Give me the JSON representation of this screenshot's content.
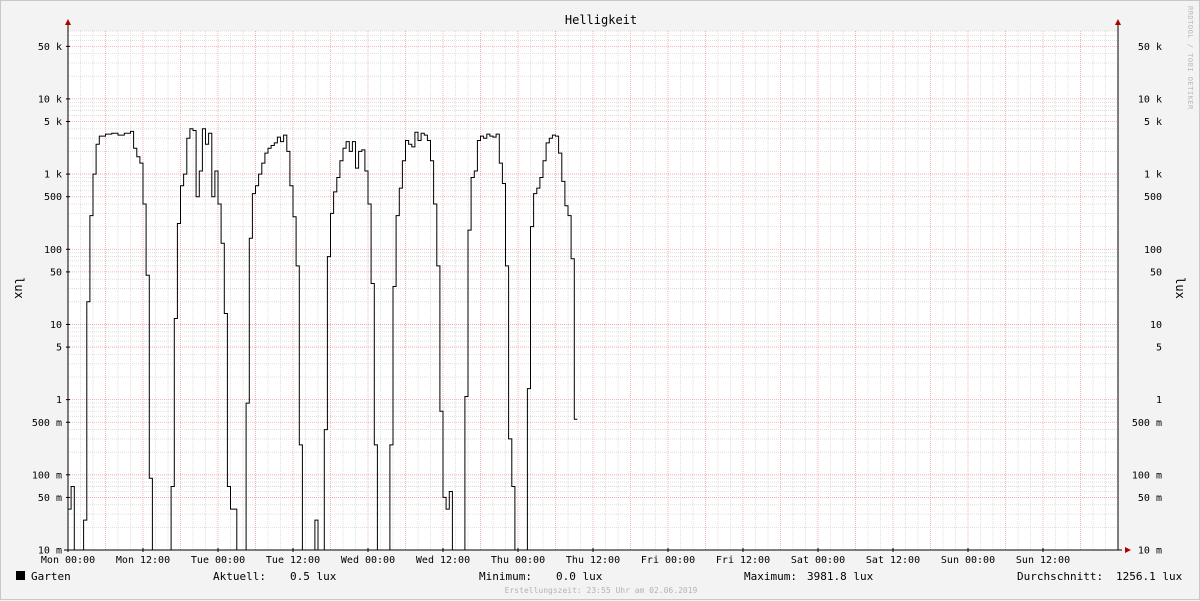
{
  "chart_data": {
    "type": "line",
    "title": "Helligkeit",
    "ylabel": "lux",
    "ylabel_right": "lux",
    "watermark": "RRDTOOL / TOBI OETIKER",
    "y_scale": "log",
    "ylim": [
      0.01,
      80000
    ],
    "xlim_hours": [
      0,
      168
    ],
    "x_tick_labels": [
      "Mon 00:00",
      "Mon 12:00",
      "Tue 00:00",
      "Tue 12:00",
      "Wed 00:00",
      "Wed 12:00",
      "Thu 00:00",
      "Thu 12:00",
      "Fri 00:00",
      "Fri 12:00",
      "Sat 00:00",
      "Sat 12:00",
      "Sun 00:00",
      "Sun 12:00"
    ],
    "x_tick_hours": [
      0,
      12,
      24,
      36,
      48,
      60,
      72,
      84,
      96,
      108,
      120,
      132,
      144,
      156
    ],
    "y_ticks": [
      {
        "value": 0.01,
        "label": "10 m"
      },
      {
        "value": 0.05,
        "label": "50 m"
      },
      {
        "value": 0.1,
        "label": "100 m"
      },
      {
        "value": 0.5,
        "label": "500 m"
      },
      {
        "value": 1,
        "label": "1"
      },
      {
        "value": 5,
        "label": "5"
      },
      {
        "value": 10,
        "label": "10"
      },
      {
        "value": 50,
        "label": "50"
      },
      {
        "value": 100,
        "label": "100"
      },
      {
        "value": 500,
        "label": "500"
      },
      {
        "value": 1000,
        "label": "1 k"
      },
      {
        "value": 5000,
        "label": "5 k"
      },
      {
        "value": 10000,
        "label": "10 k"
      },
      {
        "value": 50000,
        "label": "50 k"
      }
    ],
    "grid": true,
    "legend_position": "bottom-left",
    "colors": {
      "line": "#000000",
      "major_grid": "#f0a0a0",
      "minor_grid": "#d8d8d8",
      "axis": "#000000",
      "arrow": "#b00000"
    },
    "series": [
      {
        "name": "Garten",
        "color": "#000000",
        "points": [
          [
            0.0,
            0.035
          ],
          [
            0.5,
            0.07
          ],
          [
            1.0,
            0.003
          ],
          [
            2.0,
            0.003
          ],
          [
            2.5,
            0.025
          ],
          [
            3.0,
            20
          ],
          [
            3.5,
            280
          ],
          [
            4.0,
            1000
          ],
          [
            4.5,
            2500
          ],
          [
            5.0,
            3200
          ],
          [
            6.0,
            3400
          ],
          [
            7.0,
            3500
          ],
          [
            8.0,
            3300
          ],
          [
            9.0,
            3500
          ],
          [
            10.0,
            3700
          ],
          [
            10.5,
            2200
          ],
          [
            11.0,
            1700
          ],
          [
            11.5,
            1400
          ],
          [
            12.0,
            400
          ],
          [
            12.5,
            45
          ],
          [
            13.0,
            0.09
          ],
          [
            13.5,
            0.003
          ],
          [
            16.0,
            0.003
          ],
          [
            16.5,
            0.07
          ],
          [
            17.0,
            12
          ],
          [
            17.5,
            220
          ],
          [
            18.0,
            700
          ],
          [
            18.5,
            1000
          ],
          [
            19.0,
            3000
          ],
          [
            19.5,
            4000
          ],
          [
            20.0,
            3800
          ],
          [
            20.5,
            500
          ],
          [
            21.0,
            1100
          ],
          [
            21.5,
            4000
          ],
          [
            22.0,
            2500
          ],
          [
            22.5,
            3500
          ],
          [
            23.0,
            500
          ],
          [
            23.5,
            1100
          ],
          [
            24.0,
            400
          ],
          [
            24.5,
            120
          ],
          [
            25.0,
            14
          ],
          [
            25.5,
            0.07
          ],
          [
            26.0,
            0.035
          ],
          [
            27.0,
            0.003
          ],
          [
            28.0,
            0.003
          ],
          [
            28.5,
            0.9
          ],
          [
            29.0,
            140
          ],
          [
            29.5,
            550
          ],
          [
            30.0,
            700
          ],
          [
            30.5,
            1000
          ],
          [
            31.0,
            1400
          ],
          [
            31.5,
            1900
          ],
          [
            32.0,
            2200
          ],
          [
            32.5,
            2400
          ],
          [
            33.0,
            2600
          ],
          [
            33.5,
            3100
          ],
          [
            34.0,
            2700
          ],
          [
            34.5,
            3300
          ],
          [
            35.0,
            2000
          ],
          [
            35.5,
            700
          ],
          [
            36.0,
            270
          ],
          [
            36.5,
            60
          ],
          [
            37.0,
            0.25
          ],
          [
            37.5,
            0.003
          ],
          [
            39.0,
            0.003
          ],
          [
            39.5,
            0.025
          ],
          [
            40.0,
            0.003
          ],
          [
            40.5,
            0.003
          ],
          [
            41.0,
            0.4
          ],
          [
            41.5,
            80
          ],
          [
            42.0,
            300
          ],
          [
            42.5,
            580
          ],
          [
            43.0,
            900
          ],
          [
            43.5,
            1500
          ],
          [
            44.0,
            2200
          ],
          [
            44.5,
            2700
          ],
          [
            45.0,
            2000
          ],
          [
            45.5,
            2700
          ],
          [
            46.0,
            1200
          ],
          [
            46.5,
            2000
          ],
          [
            47.0,
            2100
          ],
          [
            47.5,
            1100
          ],
          [
            48.0,
            400
          ],
          [
            48.5,
            35
          ],
          [
            49.0,
            0.25
          ],
          [
            49.5,
            0.003
          ],
          [
            51.0,
            0.003
          ],
          [
            51.5,
            0.25
          ],
          [
            52.0,
            32
          ],
          [
            52.5,
            280
          ],
          [
            53.0,
            650
          ],
          [
            53.5,
            1500
          ],
          [
            54.0,
            2800
          ],
          [
            54.5,
            2500
          ],
          [
            55.0,
            2300
          ],
          [
            55.5,
            3600
          ],
          [
            56.0,
            2800
          ],
          [
            56.5,
            3500
          ],
          [
            57.0,
            3300
          ],
          [
            57.5,
            2800
          ],
          [
            58.0,
            1500
          ],
          [
            58.5,
            400
          ],
          [
            59.0,
            60
          ],
          [
            59.5,
            0.7
          ],
          [
            60.0,
            0.05
          ],
          [
            60.5,
            0.035
          ],
          [
            61.0,
            0.06
          ],
          [
            61.5,
            0.003
          ],
          [
            63.0,
            0.003
          ],
          [
            63.5,
            1.1
          ],
          [
            64.0,
            180
          ],
          [
            64.5,
            900
          ],
          [
            65.0,
            1100
          ],
          [
            65.5,
            2800
          ],
          [
            66.0,
            3200
          ],
          [
            66.5,
            3000
          ],
          [
            67.0,
            3400
          ],
          [
            67.5,
            3200
          ],
          [
            68.0,
            3100
          ],
          [
            68.5,
            3400
          ],
          [
            69.0,
            1400
          ],
          [
            69.5,
            750
          ],
          [
            70.0,
            60
          ],
          [
            70.5,
            0.3
          ],
          [
            71.0,
            0.07
          ],
          [
            71.5,
            0.003
          ],
          [
            72.0,
            0.003
          ],
          [
            73.0,
            0.003
          ],
          [
            73.5,
            1.4
          ],
          [
            74.0,
            200
          ],
          [
            74.5,
            550
          ],
          [
            75.0,
            650
          ],
          [
            75.5,
            900
          ],
          [
            76.0,
            1500
          ],
          [
            76.5,
            2600
          ],
          [
            77.0,
            3000
          ],
          [
            77.5,
            3300
          ],
          [
            78.0,
            3200
          ],
          [
            78.5,
            1900
          ],
          [
            79.0,
            800
          ],
          [
            79.5,
            380
          ],
          [
            80.0,
            280
          ],
          [
            80.5,
            75
          ],
          [
            81.0,
            0.55
          ],
          [
            81.5,
            0.55
          ]
        ]
      }
    ],
    "legend": {
      "name": "Garten",
      "swatch_color": "#000000"
    },
    "stats": {
      "current_label": "Aktuell:",
      "current_value": "0.5 lux",
      "min_label": "Minimum:",
      "min_value": "0.0 lux",
      "max_label": "Maximum:",
      "max_value": "3981.8 lux",
      "avg_label": "Durchschnitt:",
      "avg_value": "1256.1 lux"
    },
    "footer": "Erstellungszeit: 23:55 Uhr am 02.06.2019"
  }
}
